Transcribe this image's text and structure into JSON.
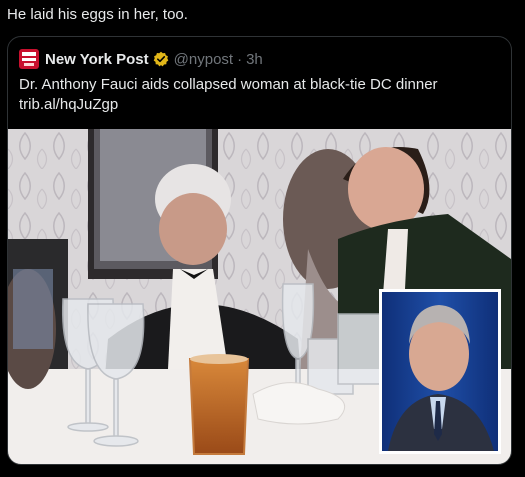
{
  "post": {
    "text": "He laid his eggs in her, too."
  },
  "quoted": {
    "source_name": "New York Post",
    "handle": "@nypost",
    "separator": "·",
    "time": "3h",
    "headline": "Dr. Anthony Fauci aids collapsed woman at black-tie DC dinner",
    "link": "trib.al/hqJuZgp",
    "avatar_icon": "new-york-post-logo-icon",
    "verified_icon": "verified-badge-icon",
    "colors": {
      "background": "#000000",
      "text": "#e7e9ea",
      "muted": "#71767b",
      "border": "#2f3336",
      "badge": "#e2b719",
      "brand": "#c8102e"
    }
  }
}
